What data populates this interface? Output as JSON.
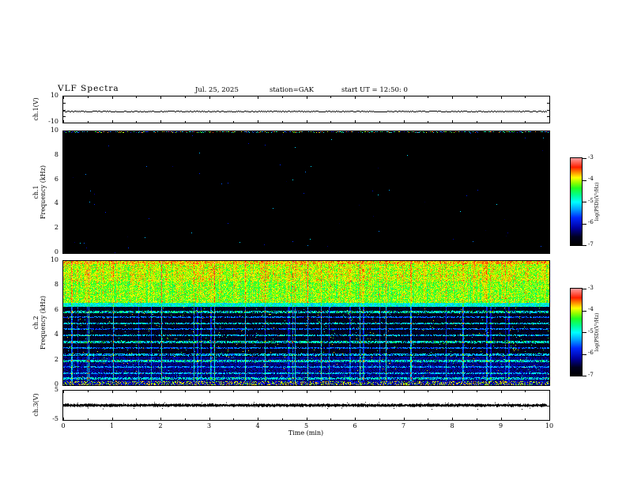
{
  "header": {
    "title": "VLF Spectra",
    "date": "Jul. 25, 2025",
    "station": "station=GAK",
    "start_ut": "start UT =  12:50: 0"
  },
  "xaxis": {
    "label": "Time (min)",
    "range": [
      0,
      10
    ],
    "major_ticks": [
      0,
      1,
      2,
      3,
      4,
      5,
      6,
      7,
      8,
      9,
      10
    ]
  },
  "colorbar": {
    "label": "log(PSD)(V²/Hz)",
    "range": [
      -7,
      -3
    ],
    "ticks": [
      -3,
      -4,
      -5,
      -6,
      -7
    ],
    "colormap_stops": [
      {
        "t": 0.0,
        "c": "#000000"
      },
      {
        "t": 0.1,
        "c": "#000020"
      },
      {
        "t": 0.2,
        "c": "#0000a0"
      },
      {
        "t": 0.32,
        "c": "#0028ff"
      },
      {
        "t": 0.42,
        "c": "#00a8ff"
      },
      {
        "t": 0.5,
        "c": "#00ffff"
      },
      {
        "t": 0.58,
        "c": "#00ff90"
      },
      {
        "t": 0.66,
        "c": "#20ff20"
      },
      {
        "t": 0.72,
        "c": "#90ff00"
      },
      {
        "t": 0.78,
        "c": "#ffff00"
      },
      {
        "t": 0.84,
        "c": "#ff9000"
      },
      {
        "t": 0.9,
        "c": "#ff2000"
      },
      {
        "t": 1.0,
        "c": "#ff9898"
      }
    ]
  },
  "chart_data": [
    {
      "type": "line",
      "panel": "ch1-voltage",
      "ylabel": "ch.1(V)",
      "ylim": [
        -10,
        10
      ],
      "yticks": [
        10,
        -10
      ],
      "x_range_min": [
        0,
        9.9
      ],
      "series": [
        {
          "name": "ch.1 voltage",
          "description": "flat thin trace at about -1 V for the whole 10 min record"
        }
      ],
      "trace_value_v": -1.2
    },
    {
      "type": "heatmap",
      "panel": "ch1-spectrogram",
      "ylabel_lines": [
        "ch.1",
        "Frequency (kHz)"
      ],
      "ylim": [
        0,
        10
      ],
      "yticks": [
        0,
        2,
        4,
        6,
        8,
        10
      ],
      "zlim": [
        -7,
        -3
      ],
      "content": "entire spectrogram at background level about -7 (black); sparse colored specks along the 10 kHz top edge and a few isolated dots inside"
    },
    {
      "type": "heatmap",
      "panel": "ch2-spectrogram",
      "ylabel_lines": [
        "ch.2",
        "Frequency (kHz)"
      ],
      "ylim": [
        0,
        10
      ],
      "yticks": [
        0,
        2,
        4,
        6,
        8,
        10
      ],
      "zlim": [
        -7,
        -3
      ],
      "content": {
        "broadband_band_khz": [
          6.7,
          10
        ],
        "broadband_level": "strong, log PSD about -4.6 to -3.7 (green/yellow) with sparse red peaks near -3",
        "edge_band_khz": [
          6.35,
          6.7
        ],
        "hum_lines_khz": [
          5.95,
          5.5,
          5.0,
          4.55,
          4.05,
          3.5,
          3.0,
          2.5,
          2.0,
          1.5,
          1.0,
          0.55
        ],
        "background_level": "about -7 (black) to -6.3 (dark blue) below 6.3 kHz, denser blue below 2.3 kHz",
        "sferic_streaks": "frequent vertical green streaks spanning the full band throughout the record",
        "bottom_edge": "speckled red/dark band below 0.3 kHz"
      }
    },
    {
      "type": "line",
      "panel": "ch3-voltage",
      "ylabel": "ch.3(V)",
      "ylim": [
        -5,
        5
      ],
      "yticks": [
        5,
        -5
      ],
      "x_range_min": [
        0,
        9.9
      ],
      "series": [
        {
          "name": "ch.3 voltage",
          "description": "dense dark flat band at 0 V, about 0.5 V thick"
        }
      ],
      "trace_value_v": 0
    }
  ]
}
